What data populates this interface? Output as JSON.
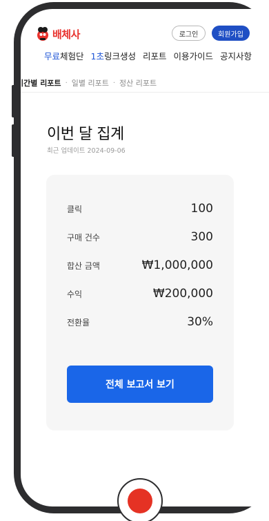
{
  "header": {
    "logo_text": "배체사",
    "login_label": "로그인",
    "signup_label": "회원가입"
  },
  "nav": {
    "item1_highlight": "무료",
    "item1_rest": "체험단",
    "item2_highlight": "1초",
    "item2_rest": "링크생성",
    "item3": "리포트",
    "item4": "이용가이드",
    "item5": "공지사항"
  },
  "subnav": {
    "active": "기간별 리포트",
    "item2": "일별 리포트",
    "item3": "정산 리포트",
    "separator": "·"
  },
  "summary": {
    "title": "이번 달 집계",
    "updated": "최근 업데이트 2024-09-06",
    "rows": [
      {
        "label": "클릭",
        "value": "100"
      },
      {
        "label": "구매 건수",
        "value": "300"
      },
      {
        "label": "합산 금액",
        "value": "₩1,000,000"
      },
      {
        "label": "수익",
        "value": "₩200,000"
      },
      {
        "label": "전환율",
        "value": "30%"
      }
    ],
    "button_label": "전체 보고서 보기"
  },
  "colors": {
    "brand_red": "#e8322d",
    "primary_blue": "#1a66e8",
    "signup_blue": "#1f4fc4"
  }
}
